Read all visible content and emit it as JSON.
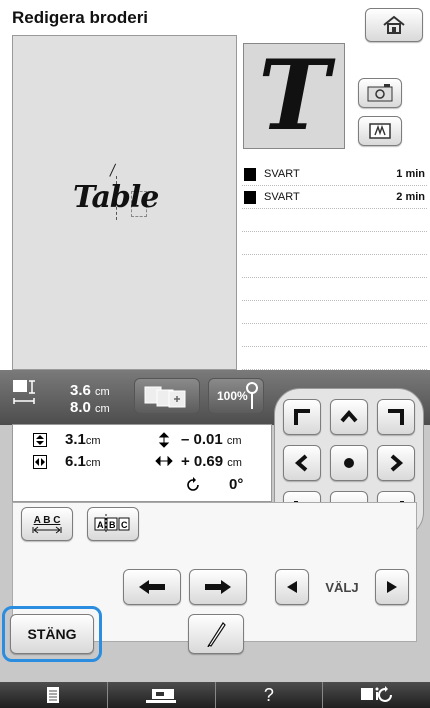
{
  "header": {
    "title": "Redigera broderi"
  },
  "preview": {
    "text": "Table"
  },
  "thumbnail": {
    "letter": "T"
  },
  "color_list": [
    {
      "name": "SVART",
      "time": "1 min",
      "color": "#000000"
    },
    {
      "name": "SVART",
      "time": "2 min",
      "color": "#000000"
    }
  ],
  "size": {
    "height_value": "3.6",
    "height_unit": "cm",
    "width_value": "8.0",
    "width_unit": "cm",
    "zoom": "100%"
  },
  "position": {
    "y_value": "3.1",
    "y_unit": "cm",
    "x_value": "6.1",
    "x_unit": "cm",
    "offset_v": "– 0.01",
    "offset_v_unit": "cm",
    "offset_h": "+ 0.69",
    "offset_h_unit": "cm",
    "rotation": "0°"
  },
  "buttons": {
    "close": "STÄNG",
    "select": "VÄLJ",
    "spacing_abc": "A B C"
  },
  "accent": {
    "highlight": "#2a8de0"
  },
  "icons": [
    "home-icon",
    "camera-icon",
    "frame-icon",
    "pen-icon",
    "document-icon",
    "sewing-machine-icon",
    "help-icon",
    "settings-icon"
  ]
}
